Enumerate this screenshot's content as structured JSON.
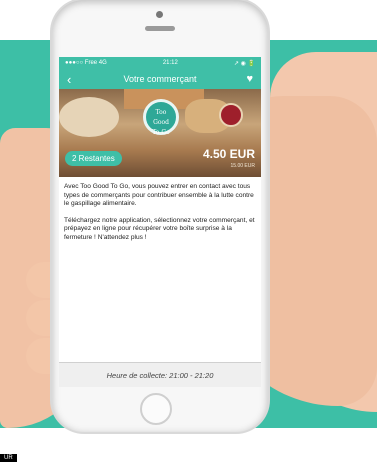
{
  "status_bar": {
    "carrier": "●●●○○ Free  4G",
    "time": "21:12",
    "icons": "↗ ◉ 🔋"
  },
  "nav": {
    "title": "Votre commerçant",
    "back_icon": "‹",
    "heart_icon": "♥"
  },
  "logo": {
    "line1": "Too",
    "line2": "Good",
    "line3": "To Go"
  },
  "offer": {
    "remaining": "2 Restantes",
    "price": "4.50 EUR",
    "original_price": "15.00 EUR"
  },
  "description": {
    "paragraph1": "Avec Too Good To Go, vous pouvez entrer en contact avec tous types de commerçants pour contribuer ensemble à la lutte contre le gaspillage alimentaire.",
    "paragraph2": "Téléchargez notre application, sélectionnez votre commerçant, et prépayez en ligne pour récupérer votre boîte surprise à la fermeture ! N'attendez plus !"
  },
  "pickup": {
    "label": "Heure de collecte: 21:00 - 21:20"
  },
  "corner_tag": "UR",
  "colors": {
    "teal": "#3dbfa6",
    "accent": "#3fbfa7"
  }
}
